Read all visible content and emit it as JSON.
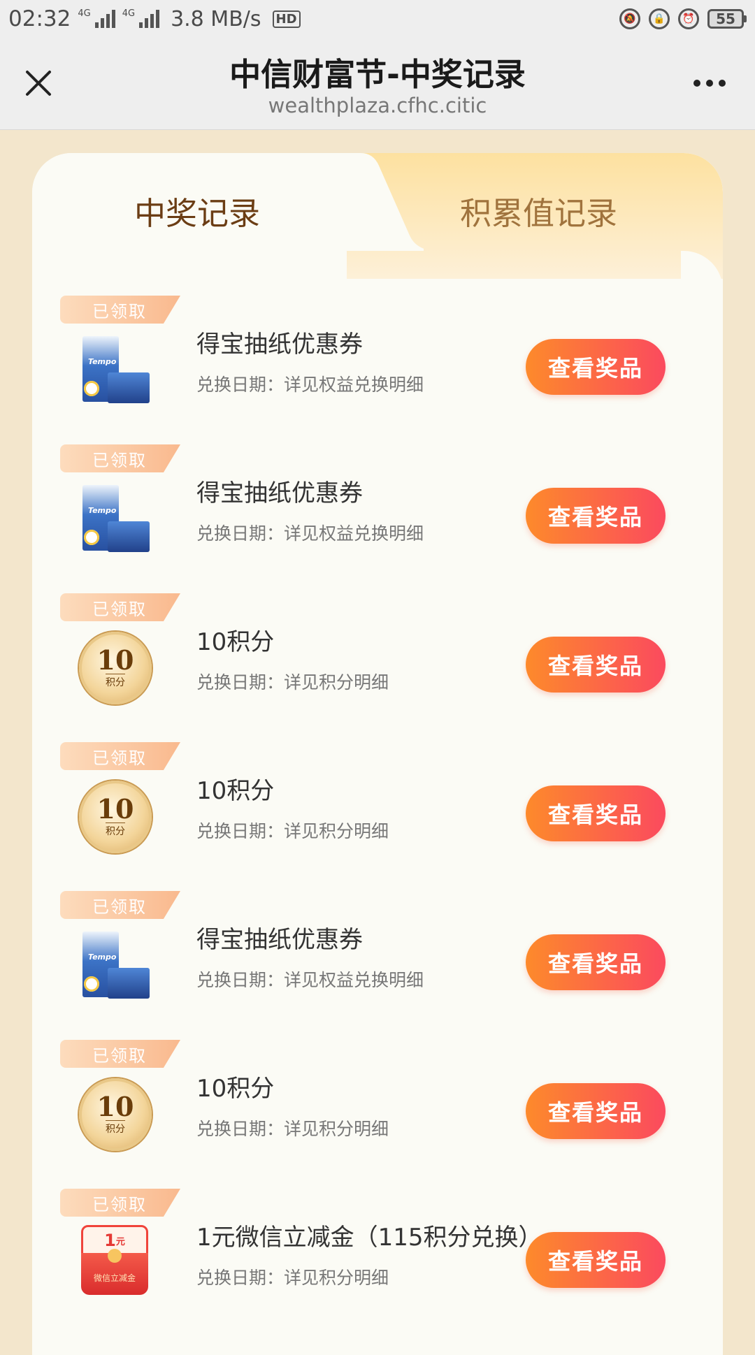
{
  "status_bar": {
    "time": "02:32",
    "network": "4G",
    "network2": "4G",
    "speed": "3.8 MB/s",
    "hd": "HD",
    "battery": "55"
  },
  "header": {
    "title": "中信财富节-中奖记录",
    "subtitle": "wealthplaza.cfhc.citic"
  },
  "tabs": {
    "active": "中奖记录",
    "inactive": "积累值记录"
  },
  "badge_label": "已领取",
  "button_label": "查看奖品",
  "items": [
    {
      "name": "得宝抽纸优惠券",
      "date": "兑换日期：详见权益兑换明细",
      "thumb": "tissue"
    },
    {
      "name": "得宝抽纸优惠券",
      "date": "兑换日期：详见权益兑换明细",
      "thumb": "tissue"
    },
    {
      "name": "10积分",
      "date": "兑换日期：详见积分明细",
      "thumb": "coin"
    },
    {
      "name": "10积分",
      "date": "兑换日期：详见积分明细",
      "thumb": "coin"
    },
    {
      "name": "得宝抽纸优惠券",
      "date": "兑换日期：详见权益兑换明细",
      "thumb": "tissue"
    },
    {
      "name": "10积分",
      "date": "兑换日期：详见积分明细",
      "thumb": "coin"
    },
    {
      "name": "1元微信立减金（115积分兑换）",
      "date": "兑换日期：详见积分明细",
      "thumb": "redpack"
    }
  ],
  "thumb_text": {
    "tissue_brand": "Tempo",
    "coin_number": "10",
    "coin_unit": "积分",
    "redpack_amount": "1",
    "redpack_unit": "元",
    "redpack_label": "微信立减金"
  }
}
